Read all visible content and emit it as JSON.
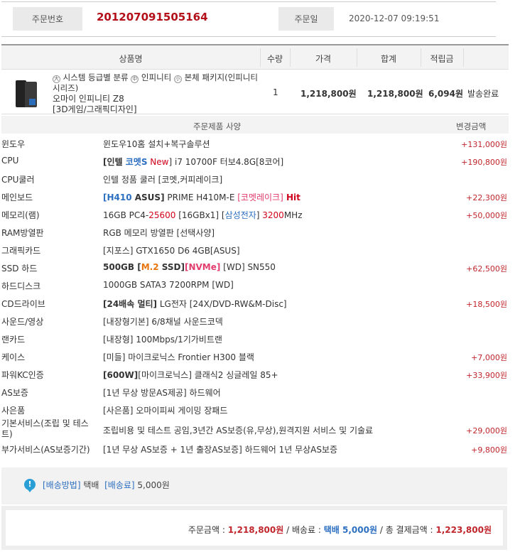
{
  "order": {
    "number_label": "주문번호",
    "number": "201207091505164",
    "date_label": "주문일",
    "date": "2020-12-07 09:19:51"
  },
  "table": {
    "headers": [
      "상품명",
      "수량",
      "가격",
      "합계",
      "적립금"
    ]
  },
  "product": {
    "category_prefix": "시스템 등급별 분류",
    "category_mid": "인피니티",
    "category_last": "본체 패키지(인피니티시리즈)",
    "circle_1": "大",
    "circle_2": "中",
    "circle_3": "小",
    "name": "오마이 인피니티 Z8",
    "sub": "[3D게임/그래픽디자인]",
    "qty": "1",
    "price": "1,218,800원",
    "total": "1,218,800원",
    "points": "6,094원",
    "status": "발송완료",
    "image_icon": "pc-case-icon"
  },
  "options_header": {
    "spec": "주문제품 사양",
    "change": "변경금액"
  },
  "options": [
    {
      "key": "윈도우",
      "value": "윈도우10홈 설치+복구솔루션",
      "price": "+131,000원"
    },
    {
      "key": "CPU",
      "v1": "[인텔 ",
      "v2": "코멧S",
      "v3": " New",
      "v4": "] i7 10700F 터보4.8G[8코어]",
      "price": "+190,800원"
    },
    {
      "key": "CPU쿨러",
      "value": "인텔 정품 쿨러 [코멧,커피레이크]",
      "price": ""
    },
    {
      "key": "메인보드",
      "v1": "[H410",
      "v2": " ASUS]",
      "v3": " PRIME H410M-E ",
      "v4": "[코멧레이크]",
      "v5": " Hit",
      "price": "+22,300원"
    },
    {
      "key": "메모리(램)",
      "v1": "16GB PC4-",
      "v2": "25600",
      "v3": " [16GBx1] [",
      "v4": "삼성전자",
      "v5": "] ",
      "v6": "3200",
      "v7": "MHz",
      "price": "+50,000원"
    },
    {
      "key": "RAM방열판",
      "value": "RGB 메모리 방열판 [선택사양]",
      "price": ""
    },
    {
      "key": "그래픽카드",
      "value": "[지포스] GTX1650 D6 4GB[ASUS]",
      "price": ""
    },
    {
      "key": "SSD 하드",
      "v1": "500GB [",
      "v2": "M.2",
      "v3": " SSD]",
      "v4": "[NVMe]",
      "v5": " [WD] SN550",
      "price": "+62,500원"
    },
    {
      "key": "하드디스크",
      "value": "1000GB SATA3 7200RPM [WD]",
      "price": ""
    },
    {
      "key": "CD드라이브",
      "v1": "[24배속 멀티]",
      "v2": " LG전자 [24X/DVD-RW&M-Disc]",
      "price": "+18,500원"
    },
    {
      "key": "사운드/영상",
      "value": "[내장형기본] 6/8채널 사운드코덱",
      "price": ""
    },
    {
      "key": "랜카드",
      "value": "[내장형] 100Mbps/1기가비트랜",
      "price": ""
    },
    {
      "key": "케이스",
      "value": "[미들] 마이크로닉스 Frontier H300 블랙",
      "price": "+7,000원"
    },
    {
      "key": "파워KC인증",
      "v1": "[600W]",
      "v2": "[마이크로닉스] 클래식2 싱글레일 85+",
      "price": "+33,900원"
    },
    {
      "key": "AS보증",
      "value": "[1년 무상 방문AS제공] 하드웨어",
      "price": ""
    },
    {
      "key": "사은품",
      "value": "[사은품] 오마이피씨 게이밍 장패드",
      "price": ""
    },
    {
      "key": "기본서비스(조립 및 테스트)",
      "value": "조립비용 및 테스트 공임,3년간 AS보증(유,무상),원격지원 서비스 및 기술료",
      "price": "+29,000원"
    },
    {
      "key": "부가서비스(AS보증기간)",
      "value": "[1년 무상 AS보증 + 1년 출장AS보증] 하드웨어 1년 무상AS보증",
      "price": "+9,800원"
    }
  ],
  "shipping": {
    "icon": "speech-bubble-icon",
    "icon_char": "!",
    "method_label": "[배송방법]",
    "method": "택배",
    "fee_label": "[배송료]",
    "fee": "5,000원"
  },
  "summary": {
    "order_label": "주문금액 : ",
    "order_amount": "1,218,800원",
    "sep1": " / 배송료 : ",
    "ship_method": "택배 5,000원",
    "sep2": " / 총 결제금액 : ",
    "total": "1,223,800원"
  }
}
